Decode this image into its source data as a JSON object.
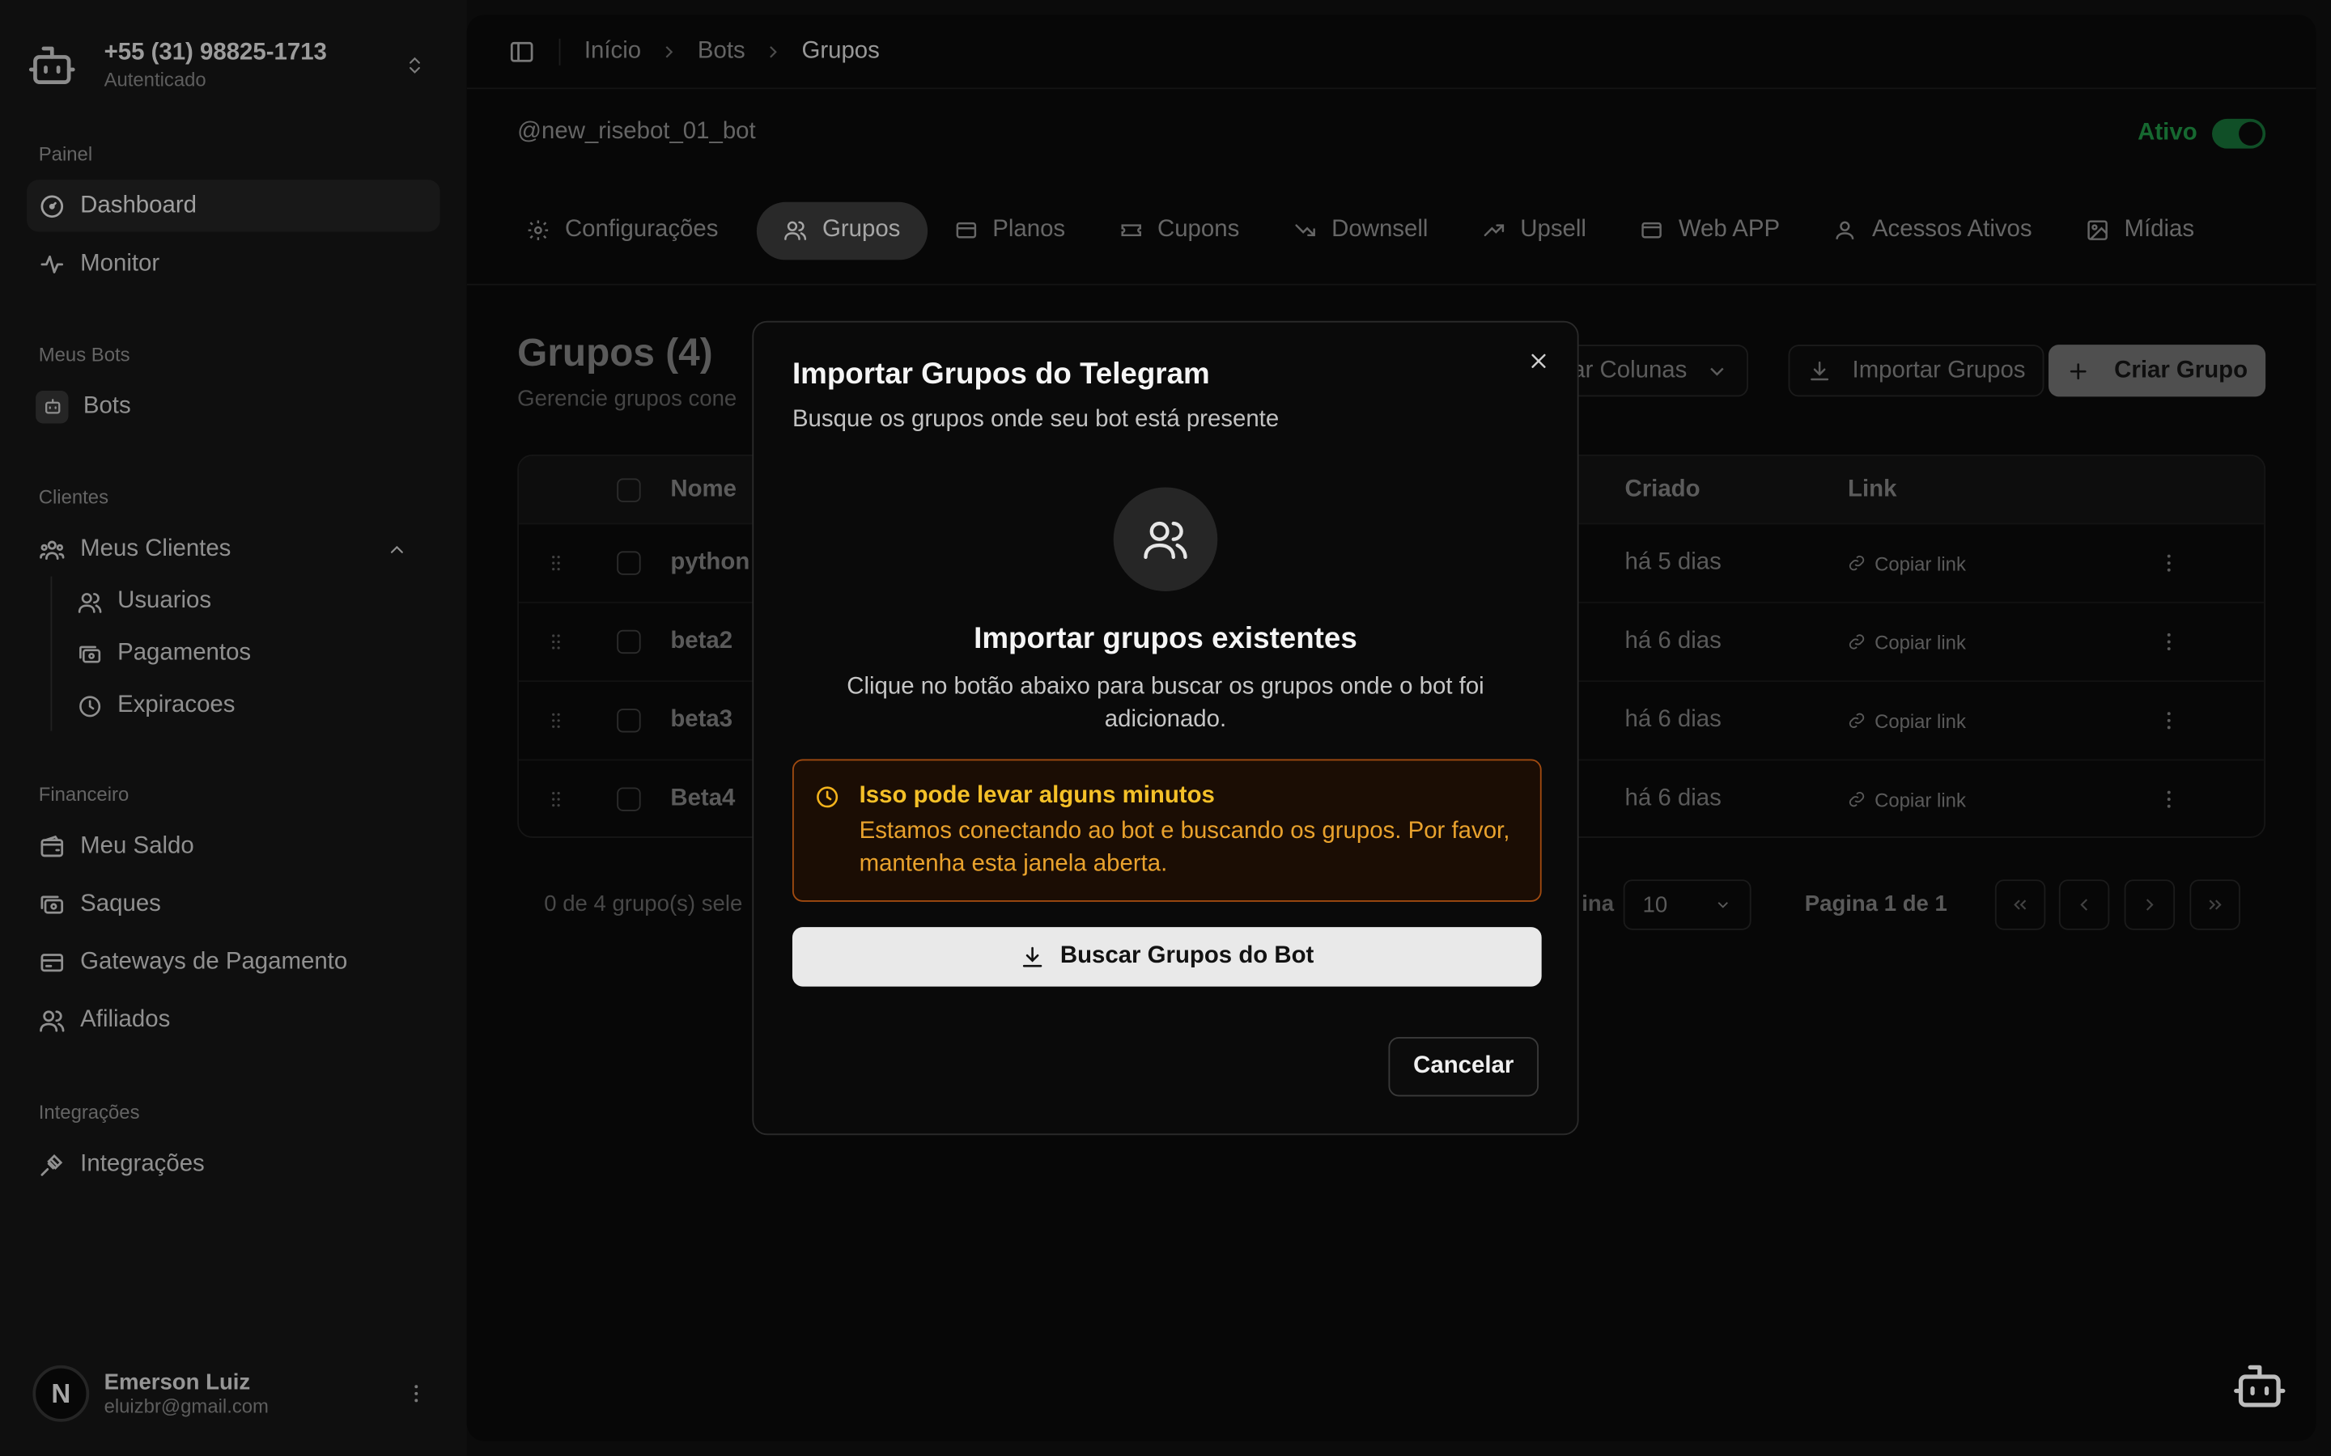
{
  "account": {
    "phone": "+55 (31) 98825-1713",
    "status": "Autenticado"
  },
  "sidebar": {
    "sections": {
      "painel": "Painel",
      "meus_bots": "Meus Bots",
      "clientes": "Clientes",
      "financeiro": "Financeiro",
      "integracoes": "Integrações"
    },
    "items": {
      "dashboard": "Dashboard",
      "monitor": "Monitor",
      "bots": "Bots",
      "meus_clientes": "Meus Clientes",
      "usuarios": "Usuarios",
      "pagamentos": "Pagamentos",
      "expiracoes": "Expiracoes",
      "meu_saldo": "Meu Saldo",
      "saques": "Saques",
      "gateways": "Gateways de Pagamento",
      "afiliados": "Afiliados",
      "integracoes": "Integrações"
    }
  },
  "user": {
    "initial": "N",
    "name": "Emerson Luiz",
    "email": "eluizbr@gmail.com"
  },
  "breadcrumb": {
    "home": "Início",
    "bots": "Bots",
    "current": "Grupos"
  },
  "bot": {
    "handle": "@new_risebot_01_bot",
    "status_label": "Ativo",
    "active": true
  },
  "tabs": [
    {
      "label": "Configurações",
      "icon": "gear-icon"
    },
    {
      "label": "Grupos",
      "icon": "users-icon",
      "active": true
    },
    {
      "label": "Planos",
      "icon": "card-icon"
    },
    {
      "label": "Cupons",
      "icon": "ticket-icon"
    },
    {
      "label": "Downsell",
      "icon": "trend-down-icon"
    },
    {
      "label": "Upsell",
      "icon": "trend-up-icon"
    },
    {
      "label": "Web APP",
      "icon": "window-icon"
    },
    {
      "label": "Acessos Ativos",
      "icon": "user-icon"
    },
    {
      "label": "Mídias",
      "icon": "image-icon"
    }
  ],
  "page": {
    "title": "Grupos (4)",
    "subtitle": "Gerencie grupos cone",
    "customize_columns": "nizar Colunas",
    "import_groups": "Importar Grupos",
    "create_group": "Criar Grupo"
  },
  "table": {
    "headers": {
      "name": "Nome",
      "created": "Criado",
      "link": "Link"
    },
    "rows": [
      {
        "name": "python",
        "created": "há 5 dias",
        "link": "Copiar link"
      },
      {
        "name": "beta2",
        "created": "há 6 dias",
        "link": "Copiar link"
      },
      {
        "name": "beta3",
        "created": "há 6 dias",
        "link": "Copiar link"
      },
      {
        "name": "Beta4",
        "created": "há 6 dias",
        "link": "Copiar link"
      }
    ]
  },
  "pagination": {
    "selected_text": "0 de 4 grupo(s) sele",
    "per_page_label": "ina",
    "per_page": "10",
    "page_text": "Pagina 1 de 1"
  },
  "modal": {
    "title": "Importar Grupos do Telegram",
    "subtitle": "Busque os grupos onde seu bot está presente",
    "heading": "Importar grupos existentes",
    "description": "Clique no botão abaixo para buscar os grupos onde o bot foi adicionado.",
    "warning_title": "Isso pode levar alguns minutos",
    "warning_text": "Estamos conectando ao bot e buscando os grupos. Por favor, mantenha esta janela aberta.",
    "primary_button": "Buscar Grupos do Bot",
    "cancel_button": "Cancelar"
  },
  "colors": {
    "active_green": "#22a04b",
    "warning_border": "#a04a10",
    "warning_text": "#e9a22d"
  }
}
